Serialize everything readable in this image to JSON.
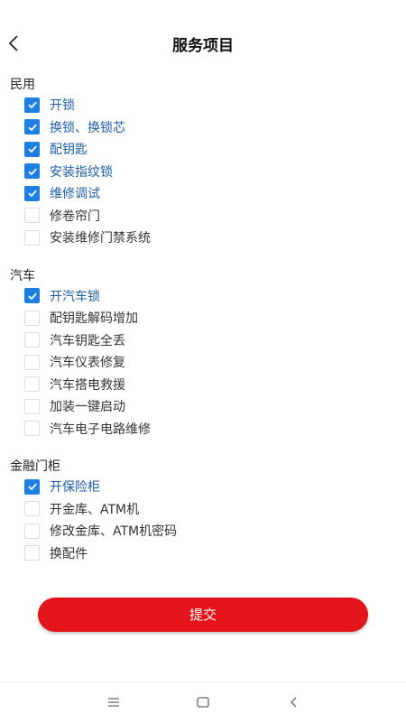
{
  "header": {
    "title": "服务项目"
  },
  "groups": [
    {
      "title": "民用",
      "options": [
        {
          "label": "开锁",
          "checked": true
        },
        {
          "label": "换锁、换锁芯",
          "checked": true
        },
        {
          "label": "配钥匙",
          "checked": true
        },
        {
          "label": "安装指纹锁",
          "checked": true
        },
        {
          "label": "维修调试",
          "checked": true
        },
        {
          "label": "修卷帘门",
          "checked": false
        },
        {
          "label": "安装维修门禁系统",
          "checked": false
        }
      ]
    },
    {
      "title": "汽车",
      "options": [
        {
          "label": "开汽车锁",
          "checked": true
        },
        {
          "label": "配钥匙解码增加",
          "checked": false
        },
        {
          "label": "汽车钥匙全丢",
          "checked": false
        },
        {
          "label": "汽车仪表修复",
          "checked": false
        },
        {
          "label": "汽车搭电救援",
          "checked": false
        },
        {
          "label": "加装一键启动",
          "checked": false
        },
        {
          "label": "汽车电子电路维修",
          "checked": false
        }
      ]
    },
    {
      "title": "金融门柜",
      "options": [
        {
          "label": "开保险柜",
          "checked": true
        },
        {
          "label": "开金库、ATM机",
          "checked": false
        },
        {
          "label": "修改金库、ATM机密码",
          "checked": false
        },
        {
          "label": "换配件",
          "checked": false
        }
      ]
    }
  ],
  "submit_label": "提交",
  "colors": {
    "accent": "#1d7fe0",
    "checked_text": "#1d5ea8",
    "submit": "#e3141a"
  },
  "icons": {
    "back": "chevron-left-icon",
    "menu": "menu-icon",
    "home": "home-icon",
    "nav_back": "nav-back-icon"
  }
}
